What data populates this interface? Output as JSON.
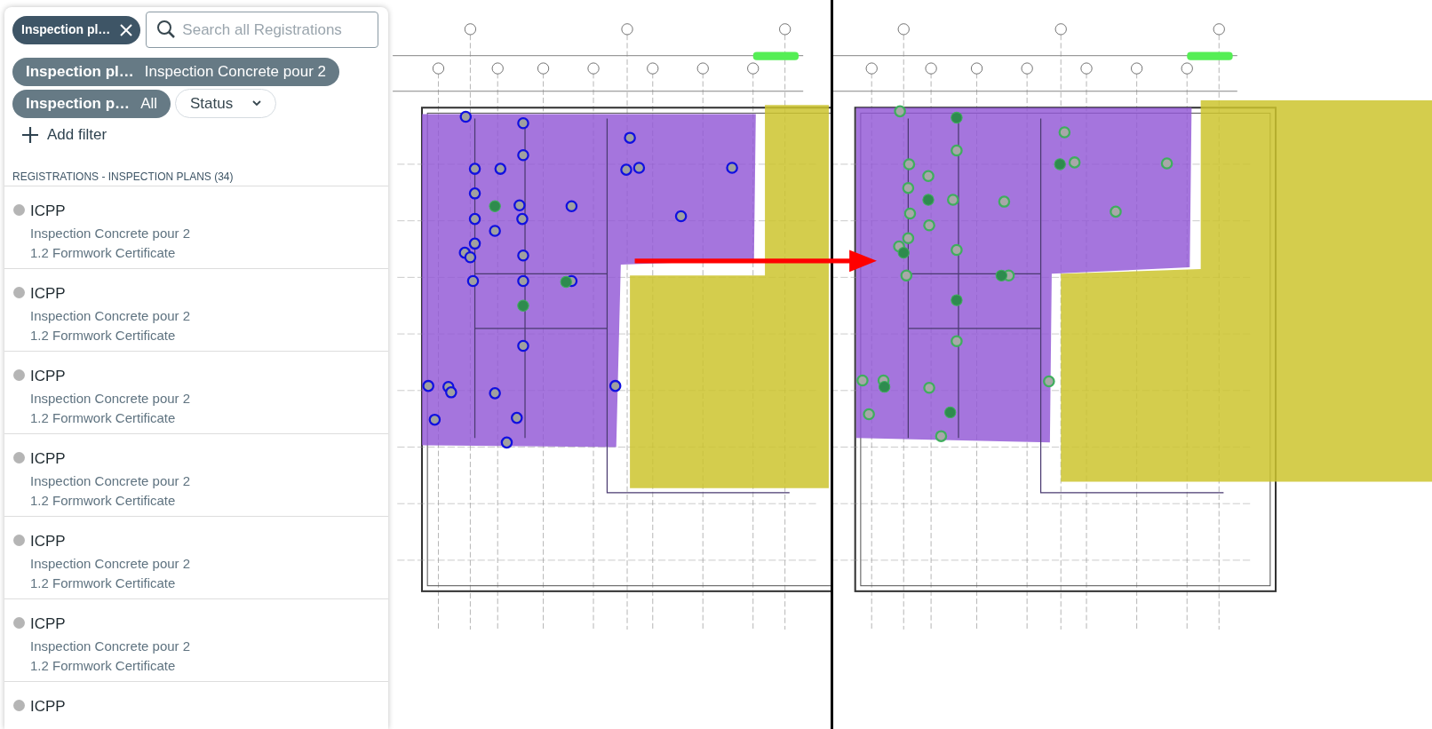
{
  "search_bar": {
    "chip": {
      "label": "Inspection pl…"
    },
    "placeholder": "Search all Registrations"
  },
  "filter_chips": [
    {
      "label": "Inspection pl…",
      "value": "Inspection Concrete pour 2"
    },
    {
      "label": "Inspection p…",
      "value": "All"
    }
  ],
  "status_dropdown": {
    "label": "Status"
  },
  "add_filter": "Add filter",
  "list_header": "REGISTRATIONS - INSPECTION PLANS (34)",
  "items": [
    {
      "title": "ICPP",
      "subtitle": "Inspection Concrete pour 2",
      "detail": "1.2 Formwork Certificate"
    },
    {
      "title": "ICPP",
      "subtitle": "Inspection Concrete pour 2",
      "detail": "1.2 Formwork Certificate"
    },
    {
      "title": "ICPP",
      "subtitle": "Inspection Concrete pour 2",
      "detail": "1.2 Formwork Certificate"
    },
    {
      "title": "ICPP",
      "subtitle": "Inspection Concrete pour 2",
      "detail": "1.2 Formwork Certificate"
    },
    {
      "title": "ICPP",
      "subtitle": "Inspection Concrete pour 2",
      "detail": "1.2 Formwork Certificate"
    },
    {
      "title": "ICPP",
      "subtitle": "Inspection Concrete pour 2",
      "detail": "1.2 Formwork Certificate"
    },
    {
      "title": "ICPP"
    }
  ]
}
